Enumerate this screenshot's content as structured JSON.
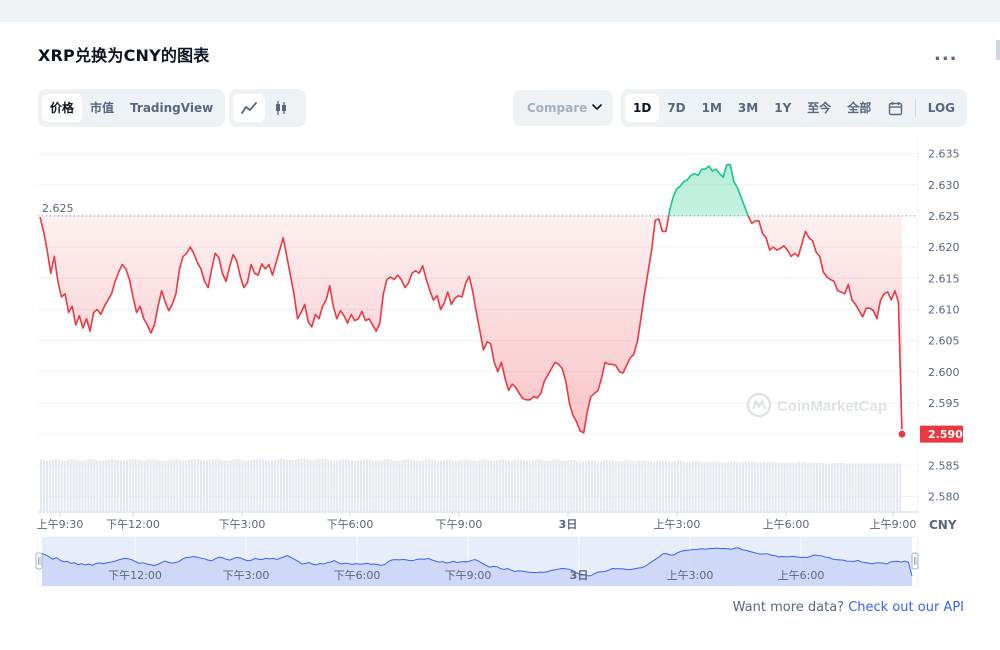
{
  "title": "XRP兑换为CNY的图表",
  "more_label": "...",
  "view_tabs": [
    {
      "label": "价格",
      "active": true
    },
    {
      "label": "市值",
      "active": false
    },
    {
      "label": "TradingView",
      "active": false
    }
  ],
  "chart_type_icons": [
    "line-chart-icon",
    "candlestick-icon"
  ],
  "compare_label": "Compare",
  "range_tabs": [
    {
      "label": "1D",
      "active": true
    },
    {
      "label": "7D",
      "active": false
    },
    {
      "label": "1M",
      "active": false
    },
    {
      "label": "3M",
      "active": false
    },
    {
      "label": "1Y",
      "active": false
    },
    {
      "label": "至今",
      "active": false
    },
    {
      "label": "全部",
      "active": false
    }
  ],
  "calendar_icon": "calendar-icon",
  "log_label": "LOG",
  "currency_label": "CNY",
  "watermark": "CoinMarketCap",
  "footer_text": "Want more data?",
  "footer_link": "Check out our API",
  "colors": {
    "up": "#16c784",
    "down": "#ea3943",
    "mini_line": "#3861fb"
  },
  "chart_data": {
    "type": "line",
    "y_ticks": [
      "2.635",
      "2.630",
      "2.625",
      "2.620",
      "2.615",
      "2.610",
      "2.605",
      "2.600",
      "2.595",
      "2.590",
      "2.585",
      "2.580"
    ],
    "x_ticks": [
      "上午9:30",
      "下午12:00",
      "下午3:00",
      "下午6:00",
      "下午9:00",
      "3日",
      "上午3:00",
      "上午6:00",
      "上午9:00"
    ],
    "mini_x_ticks": [
      "下午12:00",
      "下午3:00",
      "下午6:00",
      "下午9:00",
      "3日",
      "上午3:00",
      "上午6:00"
    ],
    "ylim": [
      2.5775,
      2.6375
    ],
    "reference_price": "2.625",
    "current_price": "2.590",
    "prices": [
      2.6248,
      2.6225,
      2.6195,
      2.6158,
      2.6185,
      2.6145,
      2.612,
      2.6125,
      2.6095,
      2.6105,
      2.6075,
      2.609,
      2.607,
      2.6085,
      2.6065,
      2.6095,
      2.61,
      2.6092,
      2.6105,
      2.6115,
      2.6125,
      2.6145,
      2.616,
      2.6172,
      2.6165,
      2.6148,
      2.612,
      2.6095,
      2.6105,
      2.6085,
      2.6075,
      2.6062,
      2.6075,
      2.6105,
      2.613,
      2.6112,
      2.6098,
      2.6108,
      2.6125,
      2.6165,
      2.6185,
      2.619,
      2.62,
      2.619,
      2.6175,
      2.6165,
      2.6145,
      2.6135,
      2.6165,
      2.619,
      2.6183,
      2.6158,
      2.6145,
      2.6168,
      2.6188,
      2.6178,
      2.6153,
      2.6135,
      2.6143,
      2.6172,
      2.6158,
      2.6155,
      2.6173,
      2.6165,
      2.6172,
      2.6155,
      2.6175,
      2.6195,
      2.6215,
      2.6185,
      2.6155,
      2.6125,
      2.6085,
      2.6095,
      2.6108,
      2.608,
      2.6072,
      2.6092,
      2.6085,
      2.6105,
      2.6115,
      2.6138,
      2.6105,
      2.6085,
      2.6098,
      2.609,
      2.6078,
      2.6092,
      2.6082,
      2.6085,
      2.6097,
      2.6082,
      2.6085,
      2.6075,
      2.6065,
      2.6078,
      2.6125,
      2.6148,
      2.6152,
      2.6148,
      2.6155,
      2.6148,
      2.6135,
      2.6142,
      2.6158,
      2.6162,
      2.6158,
      2.617,
      2.6148,
      2.613,
      2.6115,
      2.6122,
      2.61,
      2.611,
      2.6128,
      2.6108,
      2.6118,
      2.6122,
      2.612,
      2.6142,
      2.6153,
      2.6128,
      2.6095,
      2.6065,
      2.6035,
      2.6048,
      2.6045,
      2.6015,
      2.6,
      2.6015,
      2.599,
      2.597,
      2.598,
      2.5975,
      2.5965,
      2.5957,
      2.5955,
      2.5955,
      2.596,
      2.5958,
      2.5965,
      2.5985,
      2.5995,
      2.6005,
      2.6015,
      2.6012,
      2.6005,
      2.5985,
      2.595,
      2.593,
      2.592,
      2.5905,
      2.5902,
      2.5935,
      2.596,
      2.5965,
      2.597,
      2.599,
      2.6015,
      2.6012,
      2.6012,
      2.601,
      2.6,
      2.5998,
      2.601,
      2.6022,
      2.6028,
      2.6048,
      2.6085,
      2.6125,
      2.616,
      2.6195,
      2.6243,
      2.6245,
      2.6225,
      2.6225,
      2.6258,
      2.628,
      2.6293,
      2.6298,
      2.6305,
      2.6308,
      2.6315,
      2.6318,
      2.6315,
      2.6325,
      2.6325,
      2.633,
      2.6322,
      2.6325,
      2.6318,
      2.6312,
      2.6332,
      2.6332,
      2.6305,
      2.6295,
      2.628,
      2.6265,
      2.625,
      2.6238,
      2.6242,
      2.6242,
      2.6222,
      2.6215,
      2.6195,
      2.62,
      2.6195,
      2.6198,
      2.6202,
      2.6195,
      2.6185,
      2.619,
      2.6185,
      2.6205,
      2.6225,
      2.6215,
      2.621,
      2.6192,
      2.6185,
      2.616,
      2.6152,
      2.6148,
      2.6145,
      2.613,
      2.6128,
      2.6125,
      2.614,
      2.6115,
      2.6108,
      2.6098,
      2.6088,
      2.6102,
      2.6102,
      2.6098,
      2.6085,
      2.6115,
      2.6125,
      2.6128,
      2.6115,
      2.613,
      2.6112,
      2.59
    ],
    "volumes": [
      0.92,
      0.9,
      0.9,
      0.91,
      0.93,
      0.92,
      0.91,
      0.9,
      0.9,
      0.92,
      0.93,
      0.92,
      0.91,
      0.9,
      0.9,
      0.91,
      0.92,
      0.93,
      0.92,
      0.91,
      0.9,
      0.9,
      0.91,
      0.92,
      0.93,
      0.92,
      0.91,
      0.9,
      0.9,
      0.91,
      0.92,
      0.93,
      0.92,
      0.91,
      0.9,
      0.9,
      0.92,
      0.92,
      0.93,
      0.92,
      0.91,
      0.9,
      0.9,
      0.91,
      0.92,
      0.93,
      0.92,
      0.91,
      0.9,
      0.9,
      0.91,
      0.92,
      0.93,
      0.92,
      0.91,
      0.9,
      0.9,
      0.92,
      0.92,
      0.93,
      0.92,
      0.91,
      0.9,
      0.9,
      0.91,
      0.92,
      0.93,
      0.92,
      0.91,
      0.9,
      0.9,
      0.91,
      0.92,
      0.93,
      0.93,
      0.92,
      0.91,
      0.9,
      0.91,
      0.92,
      0.93,
      0.94,
      0.93,
      0.92,
      0.91,
      0.91,
      0.92,
      0.93,
      0.94,
      0.93,
      0.92,
      0.91,
      0.91,
      0.92,
      0.93,
      0.94,
      0.93,
      0.92,
      0.91,
      0.9,
      0.9,
      0.91,
      0.92,
      0.93,
      0.92,
      0.91,
      0.9,
      0.9,
      0.91,
      0.92,
      0.93,
      0.92,
      0.91,
      0.9,
      0.9,
      0.91,
      0.92,
      0.93,
      0.92,
      0.91,
      0.9,
      0.9,
      0.91,
      0.92,
      0.93,
      0.92,
      0.91,
      0.9,
      0.9,
      0.91,
      0.92,
      0.93,
      0.92,
      0.91,
      0.9,
      0.9,
      0.91,
      0.92,
      0.92,
      0.91,
      0.9,
      0.9,
      0.91,
      0.92,
      0.92,
      0.91,
      0.9,
      0.9,
      0.91,
      0.92,
      0.92,
      0.91,
      0.9,
      0.9,
      0.91,
      0.92,
      0.92,
      0.91,
      0.9,
      0.9,
      0.91,
      0.92,
      0.92,
      0.91,
      0.9,
      0.9,
      0.91,
      0.92,
      0.92,
      0.91,
      0.9,
      0.9,
      0.91,
      0.92,
      0.92,
      0.91,
      0.9,
      0.9,
      0.9,
      0.91,
      0.91,
      0.9,
      0.89,
      0.89,
      0.9,
      0.91,
      0.91,
      0.9,
      0.89,
      0.89,
      0.9,
      0.91,
      0.91,
      0.9,
      0.89,
      0.89,
      0.9,
      0.91,
      0.91,
      0.9,
      0.89,
      0.89,
      0.9,
      0.9,
      0.9,
      0.89,
      0.88,
      0.88,
      0.89,
      0.9,
      0.9,
      0.89,
      0.88,
      0.88,
      0.89,
      0.9,
      0.9,
      0.89,
      0.88,
      0.88,
      0.89,
      0.89,
      0.89,
      0.88,
      0.87,
      0.87,
      0.88,
      0.89,
      0.89,
      0.88,
      0.87,
      0.87,
      0.88,
      0.89,
      0.89,
      0.88,
      0.87,
      0.87,
      0.88,
      0.88,
      0.88,
      0.87,
      0.87,
      0.87,
      0.88,
      0.88,
      0.88,
      0.87,
      0.87,
      0.87,
      0.87,
      0.87,
      0.87,
      0.86,
      0.86,
      0.86,
      0.87,
      0.87,
      0.87,
      0.86,
      0.86,
      0.86,
      0.86,
      0.86,
      0.86,
      0.85,
      0.85,
      0.85,
      0.86,
      0.86,
      0.86,
      0.85,
      0.85,
      0.85,
      0.85,
      0.85,
      0.85,
      0.85,
      0.85,
      0.85,
      0.85,
      0.85,
      0.85,
      0.85,
      0.85,
      0.85,
      0.85,
      0.85,
      0.85,
      0.85,
      0.85
    ]
  }
}
